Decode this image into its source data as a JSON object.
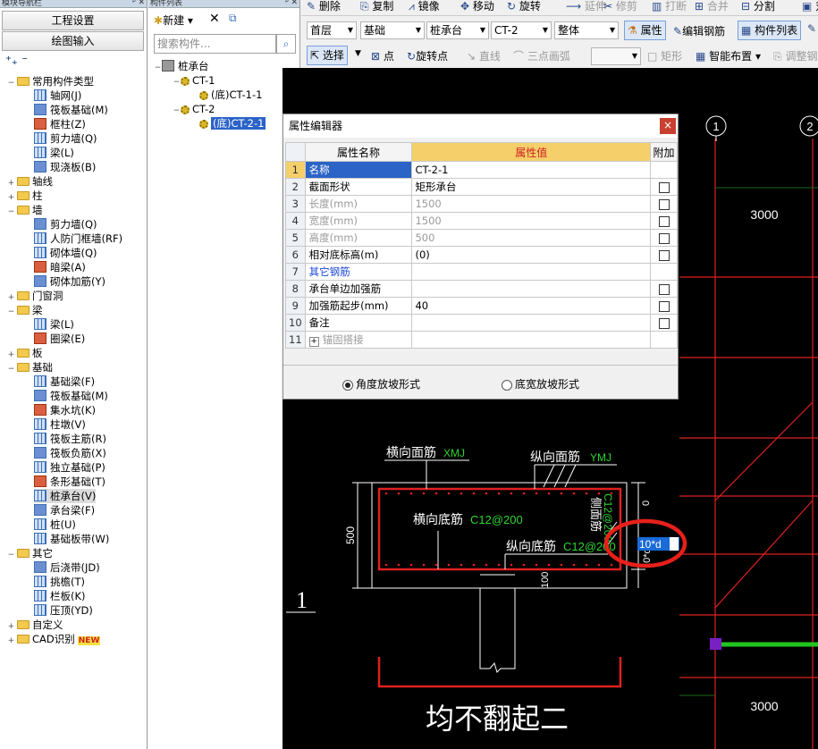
{
  "nav": {
    "title": "模块导航栏",
    "btn1": "工程设置",
    "btn2": "绘图输入",
    "tree": [
      {
        "t": "常用构件类型",
        "lvl": 0,
        "kind": "folder",
        "exp": "−"
      },
      {
        "t": "轴网(J)",
        "lvl": 1,
        "kind": "item"
      },
      {
        "t": "筏板基础(M)",
        "lvl": 1,
        "kind": "item"
      },
      {
        "t": "框柱(Z)",
        "lvl": 1,
        "kind": "item"
      },
      {
        "t": "剪力墙(Q)",
        "lvl": 1,
        "kind": "item"
      },
      {
        "t": "梁(L)",
        "lvl": 1,
        "kind": "item"
      },
      {
        "t": "现浇板(B)",
        "lvl": 1,
        "kind": "item"
      },
      {
        "t": "轴线",
        "lvl": 0,
        "kind": "folder",
        "exp": "+"
      },
      {
        "t": "柱",
        "lvl": 0,
        "kind": "folder",
        "exp": "+"
      },
      {
        "t": "墙",
        "lvl": 0,
        "kind": "folder",
        "exp": "−"
      },
      {
        "t": "剪力墙(Q)",
        "lvl": 1,
        "kind": "item"
      },
      {
        "t": "人防门框墙(RF)",
        "lvl": 1,
        "kind": "item"
      },
      {
        "t": "砌体墙(Q)",
        "lvl": 1,
        "kind": "item"
      },
      {
        "t": "暗梁(A)",
        "lvl": 1,
        "kind": "item"
      },
      {
        "t": "砌体加筋(Y)",
        "lvl": 1,
        "kind": "item"
      },
      {
        "t": "门窗洞",
        "lvl": 0,
        "kind": "folder",
        "exp": "+"
      },
      {
        "t": "梁",
        "lvl": 0,
        "kind": "folder",
        "exp": "−"
      },
      {
        "t": "梁(L)",
        "lvl": 1,
        "kind": "item"
      },
      {
        "t": "圈梁(E)",
        "lvl": 1,
        "kind": "item"
      },
      {
        "t": "板",
        "lvl": 0,
        "kind": "folder",
        "exp": "+"
      },
      {
        "t": "基础",
        "lvl": 0,
        "kind": "folder",
        "exp": "−"
      },
      {
        "t": "基础梁(F)",
        "lvl": 1,
        "kind": "item"
      },
      {
        "t": "筏板基础(M)",
        "lvl": 1,
        "kind": "item"
      },
      {
        "t": "集水坑(K)",
        "lvl": 1,
        "kind": "item"
      },
      {
        "t": "柱墩(V)",
        "lvl": 1,
        "kind": "item"
      },
      {
        "t": "筏板主筋(R)",
        "lvl": 1,
        "kind": "item"
      },
      {
        "t": "筏板负筋(X)",
        "lvl": 1,
        "kind": "item"
      },
      {
        "t": "独立基础(P)",
        "lvl": 1,
        "kind": "item"
      },
      {
        "t": "条形基础(T)",
        "lvl": 1,
        "kind": "item"
      },
      {
        "t": "桩承台(V)",
        "lvl": 1,
        "kind": "item",
        "sel": true
      },
      {
        "t": "承台梁(F)",
        "lvl": 1,
        "kind": "item"
      },
      {
        "t": "桩(U)",
        "lvl": 1,
        "kind": "item"
      },
      {
        "t": "基础板带(W)",
        "lvl": 1,
        "kind": "item"
      },
      {
        "t": "其它",
        "lvl": 0,
        "kind": "folder",
        "exp": "−"
      },
      {
        "t": "后浇带(JD)",
        "lvl": 1,
        "kind": "item"
      },
      {
        "t": "挑檐(T)",
        "lvl": 1,
        "kind": "item"
      },
      {
        "t": "栏板(K)",
        "lvl": 1,
        "kind": "item"
      },
      {
        "t": "压顶(YD)",
        "lvl": 1,
        "kind": "item"
      },
      {
        "t": "自定义",
        "lvl": 0,
        "kind": "folder",
        "exp": "+"
      },
      {
        "t": "CAD识别",
        "lvl": 0,
        "kind": "folder",
        "exp": "+",
        "badge": "NEW"
      }
    ]
  },
  "comp": {
    "title": "构件列表",
    "new": "新建",
    "search_ph": "搜索构件...",
    "tree": [
      {
        "t": "桩承台",
        "lvl": 0
      },
      {
        "t": "CT-1",
        "lvl": 1
      },
      {
        "t": "(底)CT-1-1",
        "lvl": 2
      },
      {
        "t": "CT-2",
        "lvl": 1
      },
      {
        "t": "(底)CT-2-1",
        "lvl": 2,
        "sel": true
      }
    ]
  },
  "toolbar1": {
    "items": [
      "删除",
      "复制",
      "镜像",
      "移动",
      "旋转",
      "延伸",
      "修剪",
      "打断",
      "合并",
      "分割",
      "对"
    ]
  },
  "toolbar2": {
    "floor": "首层",
    "cat": "基础",
    "type": "桩承台",
    "comp": "CT-2",
    "whole": "整体",
    "attr": "属性",
    "edit": "编辑钢筋",
    "list": "构件列表"
  },
  "toolbar3": {
    "select": "选择",
    "point": "点",
    "rotpoint": "旋转点",
    "line": "直线",
    "arc": "三点画弧",
    "rect": "矩形",
    "smart": "智能布置",
    "adjust": "调整钢"
  },
  "dialog": {
    "title": "属性编辑器",
    "col_name": "属性名称",
    "col_val": "属性值",
    "col_add": "附加",
    "rows": [
      {
        "n": "1",
        "name": "名称",
        "val": "CT-2-1",
        "cb": false,
        "style": "blue"
      },
      {
        "n": "2",
        "name": "截面形状",
        "val": "矩形承台",
        "cb": true
      },
      {
        "n": "3",
        "name": "长度(mm)",
        "val": "1500",
        "cb": true,
        "style": "g"
      },
      {
        "n": "4",
        "name": "宽度(mm)",
        "val": "1500",
        "cb": true,
        "style": "g"
      },
      {
        "n": "5",
        "name": "高度(mm)",
        "val": "500",
        "cb": true,
        "style": "g"
      },
      {
        "n": "6",
        "name": "相对底标高(m)",
        "val": "(0)",
        "cb": true
      },
      {
        "n": "7",
        "name": "其它钢筋",
        "val": "",
        "cb": false,
        "style": "blue"
      },
      {
        "n": "8",
        "name": "承台单边加强筋",
        "val": "",
        "cb": true
      },
      {
        "n": "9",
        "name": "加强筋起步(mm)",
        "val": "40",
        "cb": true
      },
      {
        "n": "10",
        "name": "备注",
        "val": "",
        "cb": true
      },
      {
        "n": "11",
        "name": "锚固搭接",
        "val": "",
        "cb": false,
        "style": "g",
        "plus": true
      }
    ],
    "radio1": "角度放坡形式",
    "radio2": "底宽放坡形式"
  },
  "drawing": {
    "axis1": "1",
    "axis2": "2",
    "dim_top": "3000",
    "dim_bottom": "3000",
    "lbl_xmj": "横向面筋",
    "xmj": "XMJ",
    "lbl_ymj": "纵向面筋",
    "ymj": "YMJ",
    "lbl_xdj": "横向底筋",
    "xdj": "C12@200",
    "lbl_ydj": "纵向底筋",
    "ydj": "C12@200",
    "side": "侧面筋",
    "side_val": "C12@200",
    "h500": "500",
    "h100": "100",
    "zero": "0",
    "ten": "10*d",
    "edit_val": "10*d",
    "big": "均不翻起二",
    "sec": "1"
  }
}
